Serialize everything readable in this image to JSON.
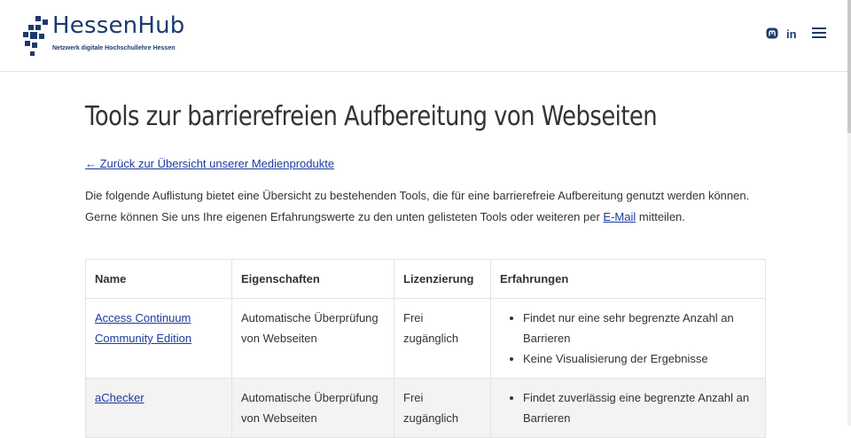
{
  "header": {
    "logo_title": "HessenHub",
    "logo_subtitle": "Netzwerk digitale Hochschullehre Hessen",
    "icons": [
      "mastodon-icon",
      "linkedin-icon",
      "menu-icon"
    ],
    "linkedin_label": "in"
  },
  "page": {
    "title": "Tools zur barrierefreien Aufbereitung von Webseiten",
    "back_link": "← Zurück zur Übersicht unserer Medienprodukte",
    "intro_1": "Die folgende Auflistung bietet eine Übersicht zu bestehenden Tools, die für eine barrierefreie Aufbereitung genutzt werden können.",
    "intro_2_before": "Gerne können Sie uns Ihre eigenen Erfahrungswerte zu den unten gelisteten Tools oder weiteren per ",
    "intro_2_link": "E-Mail",
    "intro_2_after": " mitteilen."
  },
  "table": {
    "headers": [
      "Name",
      "Eigenschaften",
      "Lizenzierung",
      "Erfahrungen"
    ],
    "rows": [
      {
        "name": "Access Continuum Community Edition",
        "properties": "Automatische Überprüfung von Webseiten",
        "license": "Frei zugänglich",
        "experiences": [
          "Findet nur eine sehr begrenzte Anzahl an Barrieren",
          "Keine Visualisierung der Ergebnisse"
        ]
      },
      {
        "name": "aChecker",
        "properties": "Automatische Überprüfung von Webseiten",
        "license": "Frei zugänglich",
        "experiences": [
          "Findet zuverlässig eine begrenzte Anzahl an Barrieren"
        ]
      }
    ]
  },
  "colors": {
    "brand": "#1d3a6e",
    "link": "#1d3a9e"
  }
}
